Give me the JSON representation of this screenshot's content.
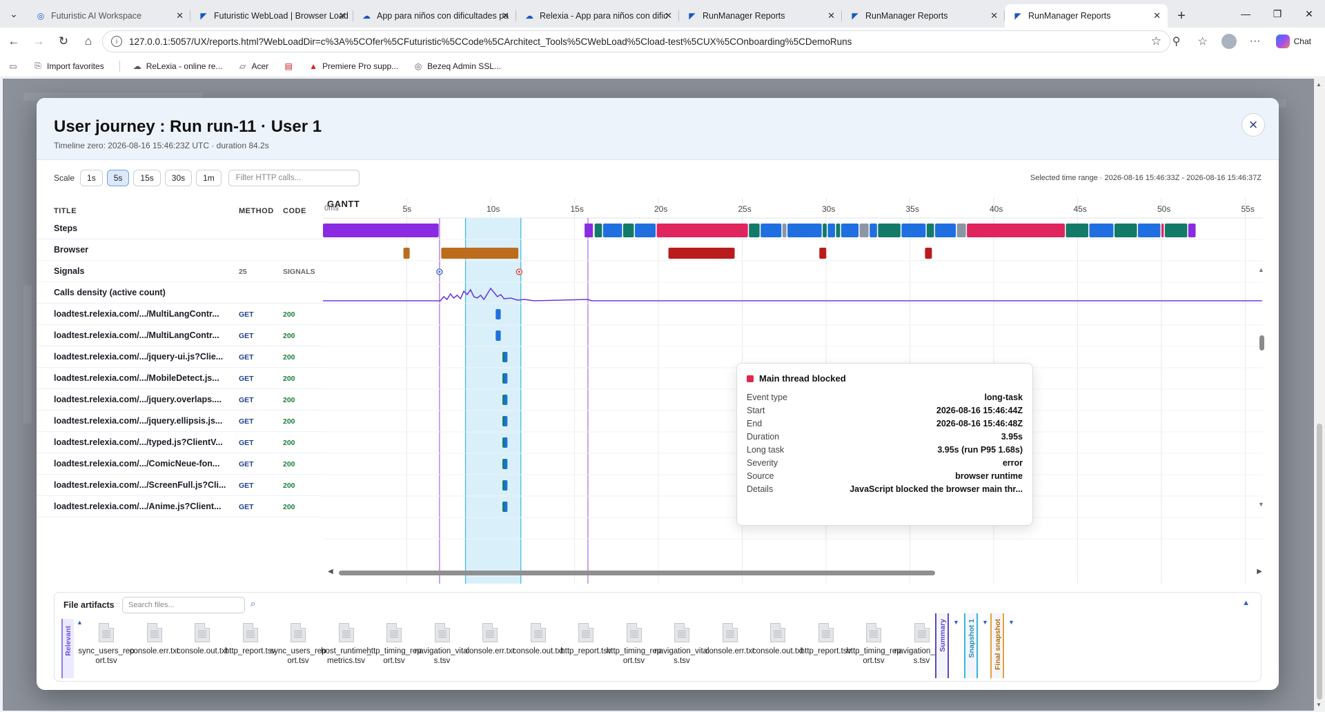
{
  "browser": {
    "tabs": [
      {
        "title": "Futuristic AI Workspace",
        "dim": true
      },
      {
        "title": "Futuristic WebLoad | Browser Load",
        "dim": false
      },
      {
        "title": "App para niños con dificultades pa",
        "dim": false
      },
      {
        "title": "Relexia - App para niños con dific",
        "dim": false
      },
      {
        "title": "RunManager Reports",
        "dim": false
      },
      {
        "title": "RunManager Reports",
        "dim": false
      },
      {
        "title": "RunManager Reports",
        "dim": false,
        "active": true
      }
    ],
    "url": "127.0.0.1:5057/UX/reports.html?WebLoadDir=c%3A%5COfer%5CFuturistic%5CCode%5CArchitect_Tools%5CWebLoad%5Cload-test%5CUX%5COnboarding%5CDemoRuns",
    "chat_label": "Chat",
    "bookmarks": [
      "Import favorites",
      "ReLexia - online re...",
      "Acer",
      "",
      "Premiere Pro supp...",
      "Bezeq Admin SSL..."
    ]
  },
  "modal": {
    "title": "User journey : Run run-11 · User 1",
    "subtitle": "Timeline zero: 2026-08-16 15:46:23Z UTC · duration 84.2s",
    "close_icon": "×",
    "scale_label": "Scale",
    "scales": [
      "1s",
      "5s",
      "15s",
      "30s",
      "1m"
    ],
    "active_scale": "5s",
    "filter_placeholder": "Filter HTTP calls...",
    "selected_range": "Selected time range · 2026-08-16 15:46:33Z - 2026-08-16 15:46:37Z",
    "columns": {
      "title": "TITLE",
      "method": "METHOD",
      "code": "CODE",
      "gantt": "GANTT",
      "zero": "0ms"
    },
    "ticks": [
      "5s",
      "10s",
      "15s",
      "20s",
      "25s",
      "30s",
      "35s",
      "40s",
      "45s",
      "50s",
      "55s"
    ],
    "rows": [
      {
        "title": "Steps",
        "method": "",
        "code": ""
      },
      {
        "title": "Browser",
        "method": "",
        "code": ""
      },
      {
        "title": "Signals",
        "method": "25",
        "code": "SIGNALS",
        "grey": true
      },
      {
        "title": "Calls density (active count)",
        "method": "",
        "code": ""
      },
      {
        "title": "loadtest.relexia.com/.../MultiLangContr...",
        "method": "GET",
        "code": "200"
      },
      {
        "title": "loadtest.relexia.com/.../MultiLangContr...",
        "method": "GET",
        "code": "200"
      },
      {
        "title": "loadtest.relexia.com/.../jquery-ui.js?Clie...",
        "method": "GET",
        "code": "200"
      },
      {
        "title": "loadtest.relexia.com/.../MobileDetect.js...",
        "method": "GET",
        "code": "200"
      },
      {
        "title": "loadtest.relexia.com/.../jquery.overlaps....",
        "method": "GET",
        "code": "200"
      },
      {
        "title": "loadtest.relexia.com/.../jquery.ellipsis.js...",
        "method": "GET",
        "code": "200"
      },
      {
        "title": "loadtest.relexia.com/.../typed.js?ClientV...",
        "method": "GET",
        "code": "200"
      },
      {
        "title": "loadtest.relexia.com/.../ComicNeue-fon...",
        "method": "GET",
        "code": "200"
      },
      {
        "title": "loadtest.relexia.com/.../ScreenFull.js?Cli...",
        "method": "GET",
        "code": "200"
      },
      {
        "title": "loadtest.relexia.com/.../Anime.js?Client...",
        "method": "GET",
        "code": "200"
      }
    ],
    "tooltip": {
      "title": "Main thread blocked",
      "fields": [
        {
          "k": "Event type",
          "v": "long-task"
        },
        {
          "k": "Start",
          "v": "2026-08-16 15:46:44Z"
        },
        {
          "k": "End",
          "v": "2026-08-16 15:46:48Z"
        },
        {
          "k": "Duration",
          "v": "3.95s"
        },
        {
          "k": "Long task",
          "v": "3.95s (run P95 1.68s)"
        },
        {
          "k": "Severity",
          "v": "error"
        },
        {
          "k": "Source",
          "v": "browser runtime"
        },
        {
          "k": "Details",
          "v": "JavaScript blocked the browser main thr..."
        }
      ]
    },
    "artifacts": {
      "title": "File artifacts",
      "search_placeholder": "Search files...",
      "relevant_label": "Relevant",
      "files": [
        "sync_users_report.tsv",
        "console.err.txt",
        "console.out.txt",
        "http_report.tsv",
        "sync_users_report.tsv",
        "host_runtime_metrics.tsv",
        "http_timing_report.tsv",
        "navigation_vitals.tsv",
        "console.err.txt",
        "console.out.txt",
        "http_report.tsv",
        "http_timing_report.tsv",
        "navigation_vitals.tsv",
        "console.err.txt",
        "console.out.txt",
        "http_report.tsv",
        "http_timing_report.tsv",
        "navigation_vitals.tsv"
      ],
      "side_tabs": [
        "Summary",
        "Snapshot 1",
        "Final snapshot"
      ]
    }
  },
  "colors": {
    "purple": "#8a2be2",
    "teal": "#137a68",
    "blue": "#1f6fe0",
    "pink": "#e0245e",
    "grey": "#8c96a3",
    "orange": "#bc6c1c",
    "red": "#b91c1c",
    "selection": "#d9f0fb",
    "cursor": "#b07de8"
  }
}
